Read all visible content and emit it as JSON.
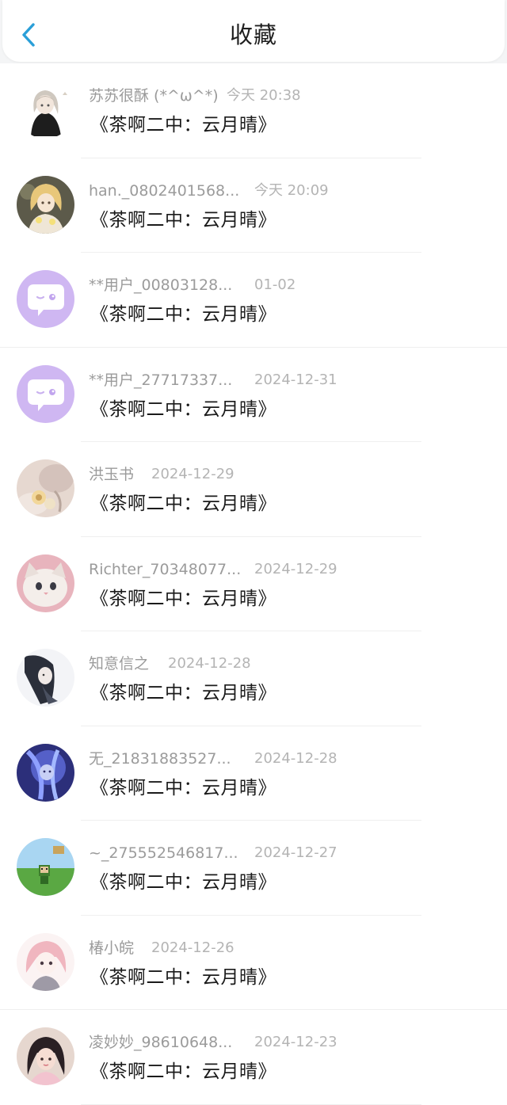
{
  "header": {
    "title": "收藏"
  },
  "items": [
    {
      "name": "苏苏很酥 (*^ω^*)",
      "date": "今天 20:38",
      "title": "《茶啊二中：云月晴》",
      "avatar": "avatar-girl-sketch"
    },
    {
      "name": "han._0802401568...",
      "date": "今天 20:09",
      "title": "《茶啊二中：云月晴》",
      "avatar": "avatar-doll"
    },
    {
      "name": "**用户_00803128...",
      "date": "01-02",
      "title": "《茶啊二中：云月晴》",
      "avatar": "avatar-default-chat"
    },
    {
      "name": "**用户_27717337...",
      "date": "2024-12-31",
      "title": "《茶啊二中：云月晴》",
      "avatar": "avatar-default-chat"
    },
    {
      "name": "洪玉书",
      "date": "2024-12-29",
      "title": "《茶啊二中：云月晴》",
      "avatar": "avatar-flowers"
    },
    {
      "name": "Richter_70348077...",
      "date": "2024-12-29",
      "title": "《茶啊二中：云月晴》",
      "avatar": "avatar-cat"
    },
    {
      "name": "知意信之",
      "date": "2024-12-28",
      "title": "《茶啊二中：云月晴》",
      "avatar": "avatar-anime-dark"
    },
    {
      "name": "无_21831883527...",
      "date": "2024-12-28",
      "title": "《茶啊二中：云月晴》",
      "avatar": "avatar-anime-blue"
    },
    {
      "name": "~_275552546817...",
      "date": "2024-12-27",
      "title": "《茶啊二中：云月晴》",
      "avatar": "avatar-game-field"
    },
    {
      "name": "椿小皖",
      "date": "2024-12-26",
      "title": "《茶啊二中：云月晴》",
      "avatar": "avatar-anime-pink"
    },
    {
      "name": "凌妙妙_98610648...",
      "date": "2024-12-23",
      "title": "《茶啊二中：云月晴》",
      "avatar": "avatar-photo-girl"
    }
  ]
}
